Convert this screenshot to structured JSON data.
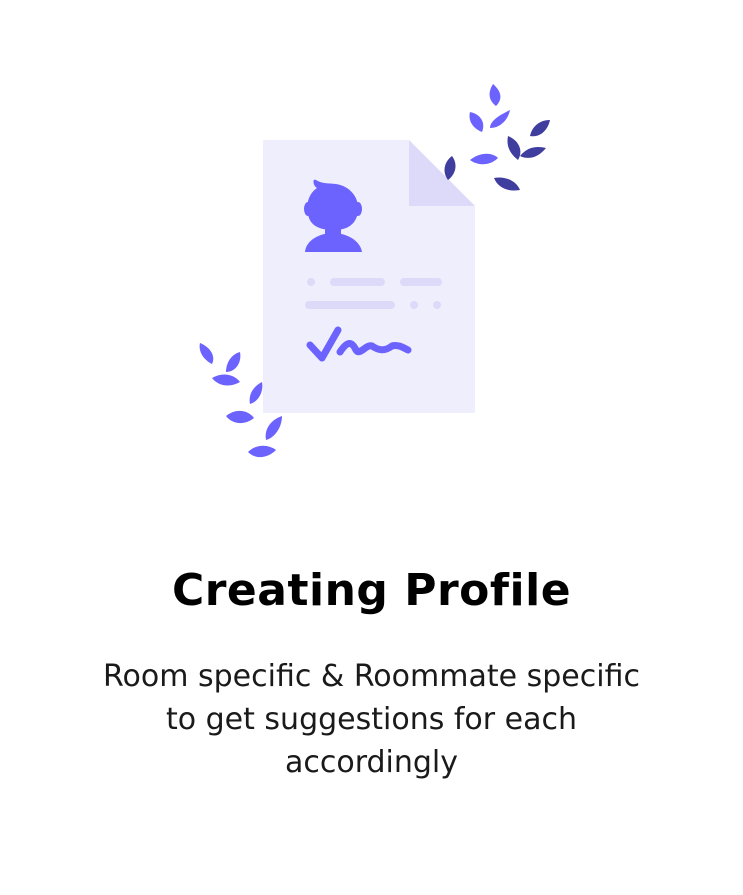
{
  "card": {
    "title": "Creating Profile",
    "description": "Room specific & Roommate specific\nto  get suggestions for each\naccordingly"
  },
  "illustration": {
    "icon": "profile-document-icon",
    "decoration_icon": "leaf-drops-icon",
    "colors": {
      "primary": "#6C63FF",
      "primary_dark": "#3F3D9E",
      "document": "#EFEEFD",
      "document_fold": "#DCDAF8",
      "lines": "#DCDAF8"
    }
  }
}
